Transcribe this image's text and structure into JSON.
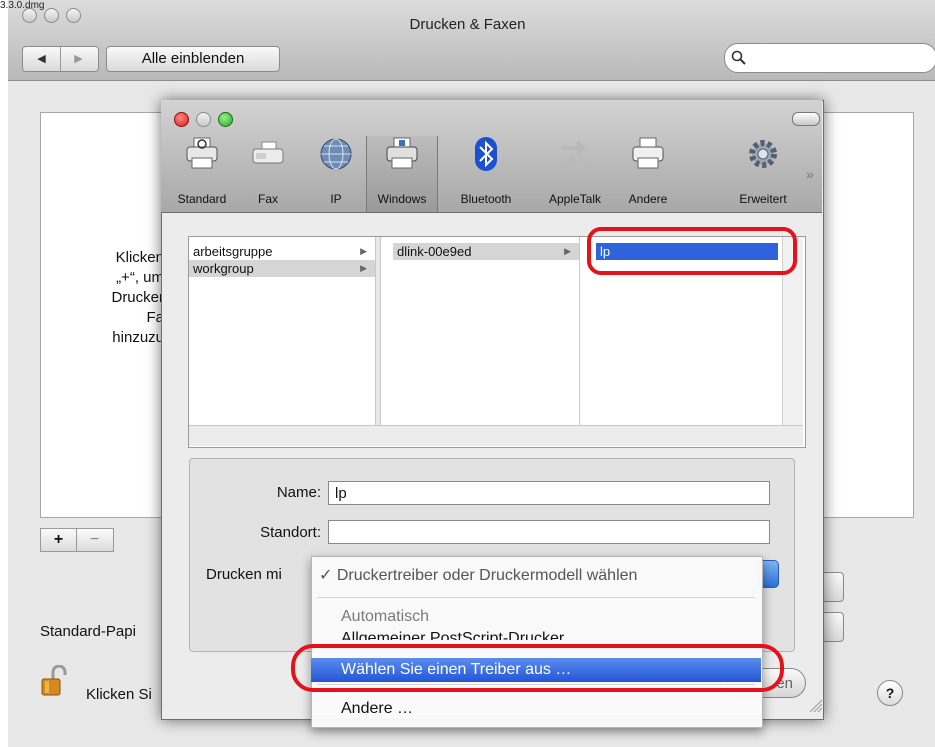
{
  "window": {
    "title": "Drucken & Faxen",
    "alle_button": "Alle einblenden",
    "top_left_label": "3.3.0.dmg"
  },
  "printer_list_hint": [
    "Klicken",
    "„+“, um",
    "Drucker",
    "Fa",
    "hinzuzu"
  ],
  "plus_minus": {
    "plus": "+",
    "minus": "−"
  },
  "bottom": {
    "standard_papier": "Standard-Papi",
    "lock_text": "Klicken Si",
    "help": "?"
  },
  "sheet": {
    "toolbar": [
      {
        "label": "Standard",
        "icon": "printer-icon"
      },
      {
        "label": "Fax",
        "icon": "fax-icon"
      },
      {
        "label": "IP",
        "icon": "globe-icon"
      },
      {
        "label": "Windows",
        "icon": "windows-printer-icon"
      },
      {
        "label": "Bluetooth",
        "icon": "bluetooth-icon"
      },
      {
        "label": "AppleTalk",
        "icon": "appletalk-icon"
      },
      {
        "label": "Andere",
        "icon": "printer-icon"
      },
      {
        "label": "Erweitert",
        "icon": "gear-icon"
      }
    ],
    "browser": {
      "col1": [
        "arbeitsgruppe",
        "workgroup"
      ],
      "col2": [
        "dlink-00e9ed"
      ],
      "col3": [
        "lp"
      ]
    },
    "form": {
      "name_label": "Name:",
      "name_value": "lp",
      "standort_label": "Standort:",
      "standort_value": "",
      "drucken_label": "Drucken mi",
      "sichern_label": "en"
    },
    "menu": {
      "check": "✓",
      "selected": "Druckertreiber oder Druckermodell wählen",
      "auto": "Automatisch",
      "postscript": "Allgemeiner PostScript-Drucker",
      "highlighted": "Wählen Sie einen Treiber aus …",
      "andere": "Andere …"
    }
  },
  "colors": {
    "highlight": "#2f63db",
    "annotation_red": "#e4121b"
  }
}
